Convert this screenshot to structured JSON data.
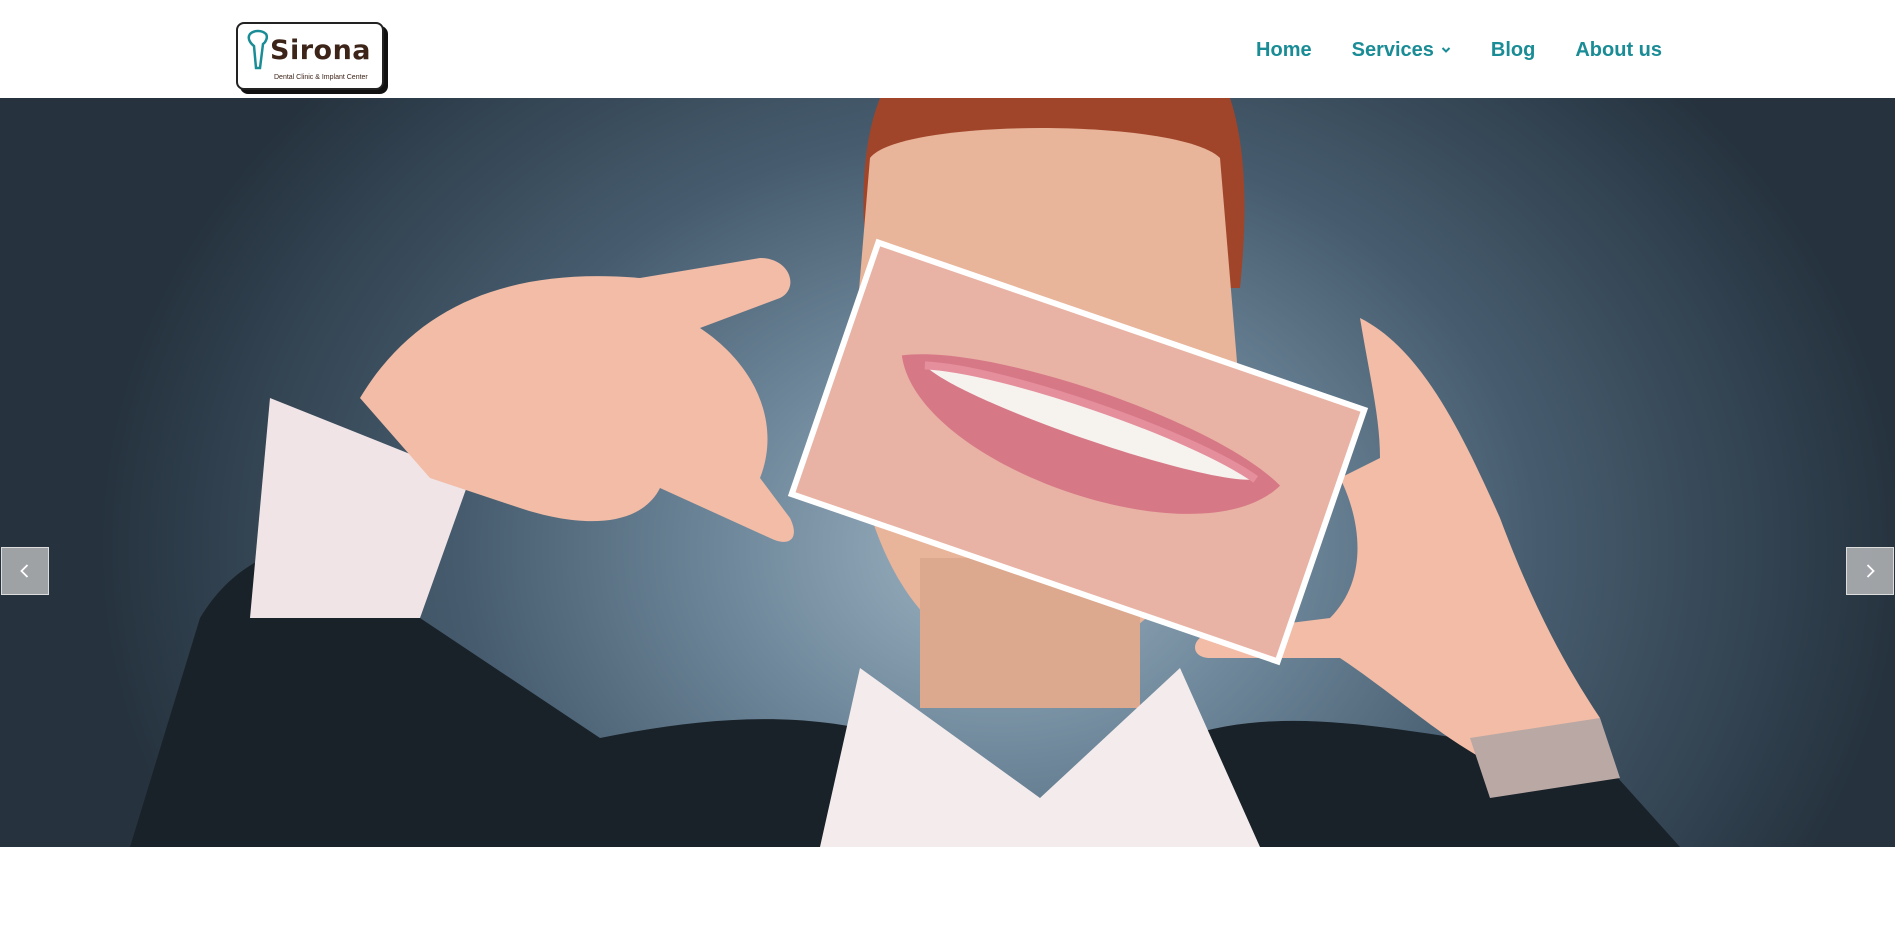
{
  "brand": {
    "name": "Sirona",
    "tagline": "Dental Clinic & Implant Center",
    "tooth_icon": "tooth-icon",
    "accent": "#1a8c96",
    "dark": "#3d2418"
  },
  "nav": {
    "home": "Home",
    "services": "Services",
    "services_icon": "chevron-down-icon",
    "blog": "Blog",
    "about": "About us"
  },
  "slider": {
    "prev_icon": "chevron-left-icon",
    "next_icon": "chevron-right-icon"
  }
}
